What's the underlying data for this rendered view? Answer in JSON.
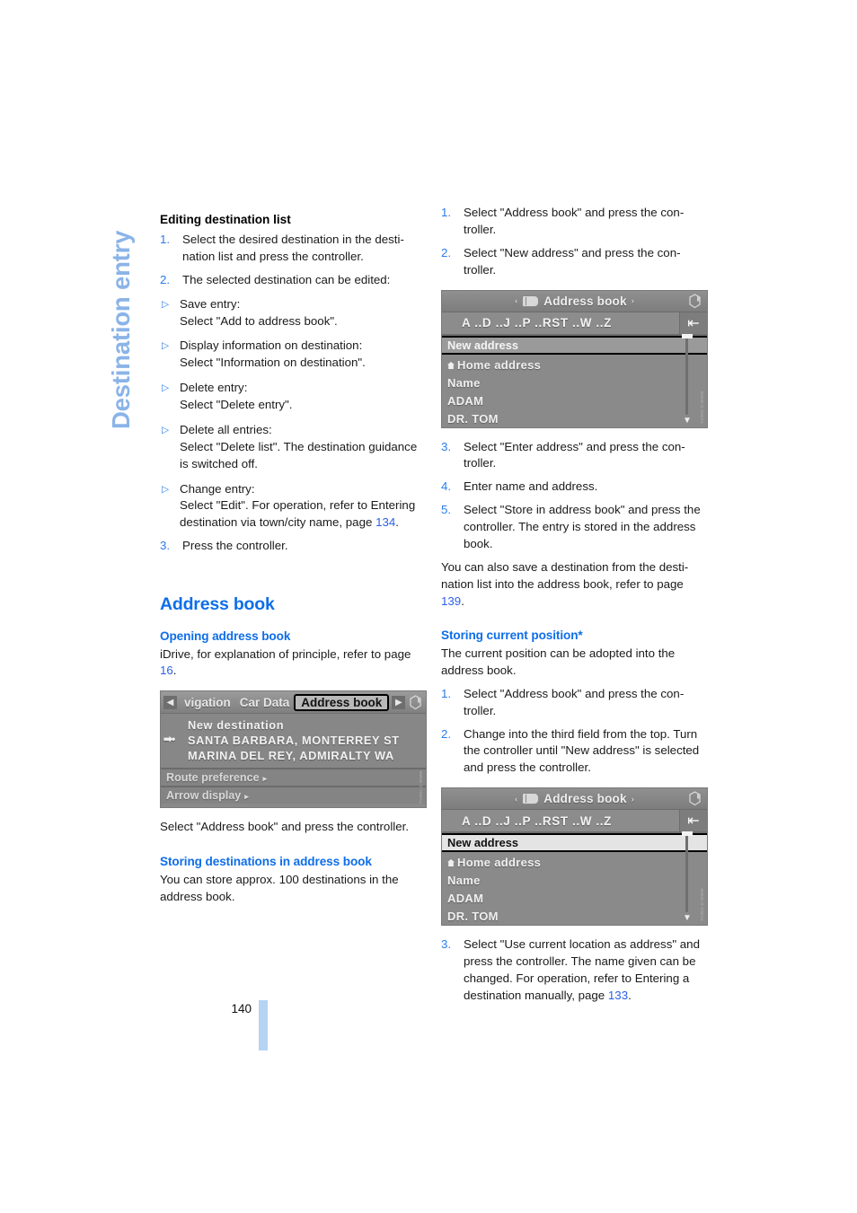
{
  "chapter": {
    "title": "Destination entry",
    "color": "#8ab4e8"
  },
  "page": {
    "number": "140"
  },
  "left_column": {
    "section_editing": {
      "heading": "Editing destination list",
      "steps": [
        {
          "num": "1.",
          "text": "Select the desired destination in the desti­nation list and press the controller."
        },
        {
          "num": "2.",
          "text": "The selected destination can be edited:"
        }
      ],
      "sub_items": [
        {
          "bullet": "▷",
          "line1": "Save entry:",
          "line2": "Select \"Add to address book\"."
        },
        {
          "bullet": "▷",
          "line1": "Display information on destination:",
          "line2": "Select \"Information on destination\"."
        },
        {
          "bullet": "▷",
          "line1": "Delete entry:",
          "line2": "Select \"Delete entry\"."
        },
        {
          "bullet": "▷",
          "line1": "Delete all entries:",
          "line2": "Select \"Delete list\". The destination guidance is switched off."
        },
        {
          "bullet": "▷",
          "line1": "Change entry:",
          "line2": "Select \"Edit\". For operation, refer to Entering destination via town/city name, page ",
          "ref": "134",
          "after": "."
        }
      ],
      "last_step": {
        "num": "3.",
        "text": "Press the controller."
      }
    },
    "section_address_book": {
      "heading": "Address book",
      "sub_opening": {
        "heading": "Opening address book",
        "text_before": "iDrive, for explanation of principle, refer to page ",
        "ref": "16",
        "text_after": "."
      },
      "caption_after_shot": "Select \"Address book\" and press the controller.",
      "sub_storing": {
        "heading": "Storing destinations in address book",
        "text": "You can store approx. 100 destinations in the address book."
      }
    },
    "nav_screenshot": {
      "tabs": [
        {
          "label": "vigation",
          "active": false
        },
        {
          "label": "Car Data",
          "active": false
        },
        {
          "label": "Address book",
          "active": true
        }
      ],
      "arrow_left": "◀",
      "arrow_right": "▶",
      "rows": [
        {
          "marker": "",
          "label": "New destination"
        },
        {
          "marker": "➡•",
          "label": "SANTA BARBARA, MONTERREY ST"
        },
        {
          "marker": "",
          "label": "MARINA DEL REY, ADMIRALTY WA"
        }
      ],
      "menu_rows": [
        {
          "label": "Route preference",
          "chev": "▸"
        },
        {
          "label": "Arrow display",
          "chev": "▸"
        }
      ],
      "sidecode": "TGR01-D-WWW"
    }
  },
  "right_column": {
    "steps_top": [
      {
        "num": "1.",
        "text": "Select \"Address book\" and press the con­troller."
      },
      {
        "num": "2.",
        "text": "Select \"New address\" and press the con­troller."
      }
    ],
    "address_book_shot_1": {
      "title": "Address book",
      "caret_left": "‹",
      "caret_right": "›",
      "alphabet": "A ..D ..J ..P ..RST ..W ..Z",
      "back_icon": "⇤",
      "selected_row": "New address",
      "selected_highlighted": false,
      "items": [
        {
          "icon": "home",
          "label": "Home address"
        },
        {
          "icon": "",
          "label": "Name"
        },
        {
          "icon": "",
          "label": "ADAM"
        },
        {
          "icon": "",
          "label": "DR. TOM"
        }
      ],
      "scroll_down": "▼",
      "sidecode": "TGR01-D-WWW"
    },
    "steps_mid": [
      {
        "num": "3.",
        "text": "Select \"Enter address\" and press the con­troller."
      },
      {
        "num": "4.",
        "text": "Enter name and address."
      },
      {
        "num": "5.",
        "text": "Select \"Store in address book\" and press the controller. The entry is stored in the address book."
      }
    ],
    "note_save": {
      "text_before": "You can also save a destination from the desti­nation list into the address book, refer to page ",
      "ref": "139",
      "text_after": "."
    },
    "section_storing_position": {
      "heading": "Storing current position*",
      "intro": "The current position can be adopted into the address book.",
      "steps": [
        {
          "num": "1.",
          "text": "Select \"Address book\" and press the con­troller."
        },
        {
          "num": "2.",
          "text": "Change into the third field from the top. Turn the controller until \"New address\" is selected and press the controller."
        }
      ]
    },
    "address_book_shot_2": {
      "title": "Address book",
      "caret_left": "‹",
      "caret_right": "›",
      "alphabet": "A ..D ..J ..P ..RST ..W ..Z",
      "back_icon": "⇤",
      "selected_row": "New address",
      "selected_highlighted": true,
      "items": [
        {
          "icon": "home",
          "label": "Home address"
        },
        {
          "icon": "",
          "label": "Name"
        },
        {
          "icon": "",
          "label": "ADAM"
        },
        {
          "icon": "",
          "label": "DR. TOM"
        }
      ],
      "scroll_down": "▼",
      "sidecode": "TGR01-D-WWW"
    },
    "step_last": {
      "num": "3.",
      "text_before": "Select \"Use current location as address\" and press the controller. The name given can be changed. For oper­ation, refer to Entering a destination manu­ally, page ",
      "ref": "133",
      "text_after": "."
    }
  }
}
